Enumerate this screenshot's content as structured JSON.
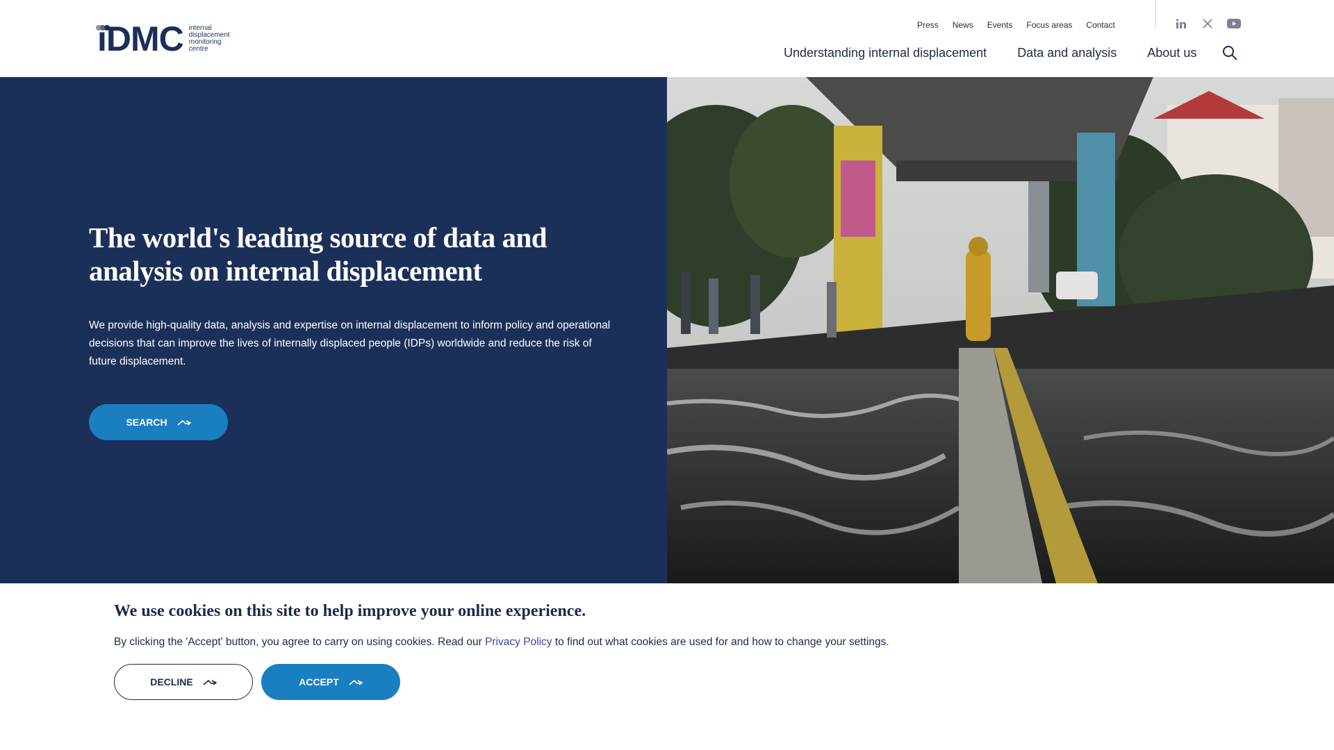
{
  "header": {
    "logo": {
      "mark": "iDMC",
      "lines": [
        "internal",
        "displacement",
        "monitoring",
        "centre"
      ]
    },
    "top_links": [
      "Press",
      "News",
      "Events",
      "Focus areas",
      "Contact"
    ],
    "social_icons": [
      "linkedin-icon",
      "x-twitter-icon",
      "youtube-icon"
    ],
    "main_nav": [
      "Understanding internal displacement",
      "Data and analysis",
      "About us"
    ],
    "search_icon": "search-icon"
  },
  "hero": {
    "title": "The world's leading source of data and analysis on internal displacement",
    "description": "We provide high-quality data, analysis and expertise on internal displacement to inform policy and operational decisions that can improve the lives of internally displaced people (IDPs) worldwide and reduce the risk of future displacement.",
    "search_button": "SEARCH",
    "colors": {
      "panel": "#1b3059",
      "accent": "#1a7fc1"
    }
  },
  "cookie": {
    "title": "We use cookies on this site to help improve your online experience.",
    "text_before": "By clicking the 'Accept' button, you agree to carry on using cookies. Read our ",
    "link": "Privacy Policy",
    "text_after": " to find out what cookies are used for and how to change your settings.",
    "decline": "DECLINE",
    "accept": "ACCEPT"
  }
}
